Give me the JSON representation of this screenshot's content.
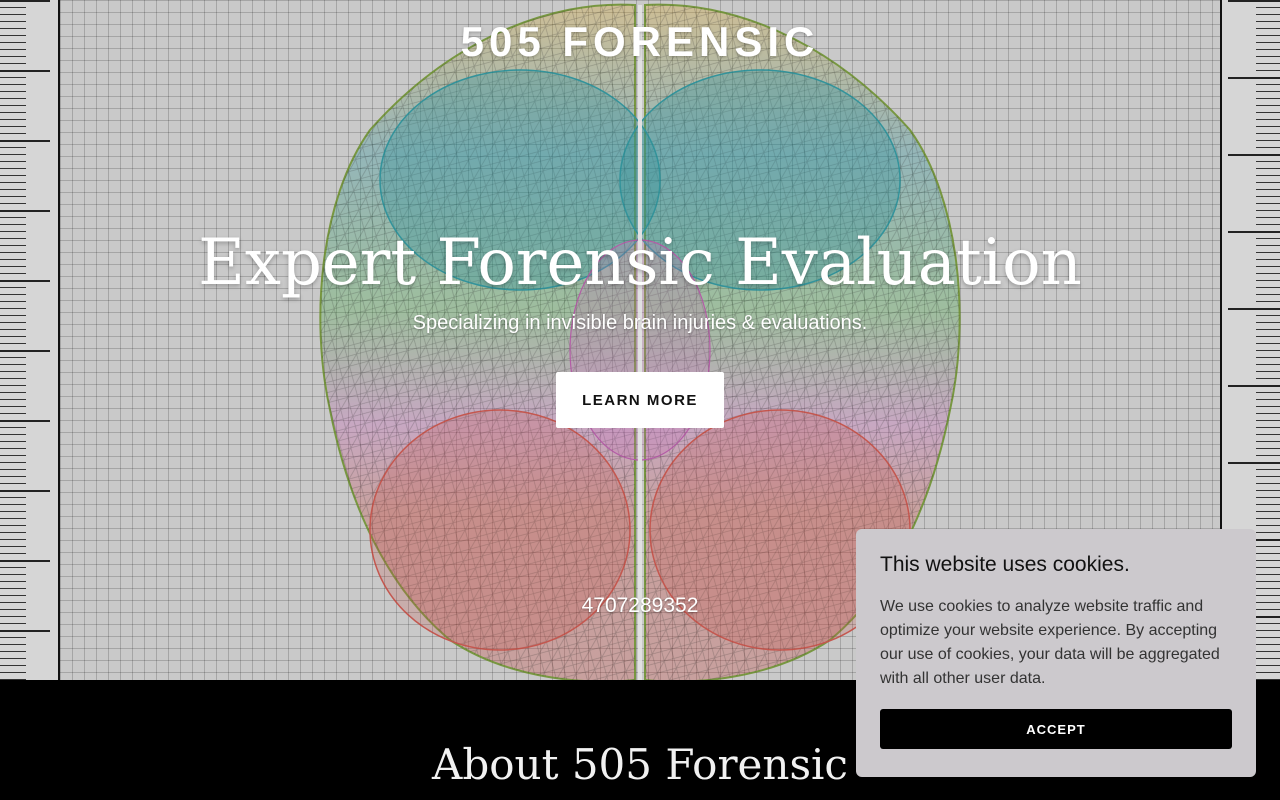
{
  "header": {
    "logo_text": "505 FORENSIC"
  },
  "hero": {
    "headline": "Expert Forensic Evaluation",
    "subheadline": "Specializing in invisible brain injuries & evaluations.",
    "cta_label": "LEARN MORE",
    "phone": "4707289352"
  },
  "about": {
    "heading": "About 505 Forensic"
  },
  "cookie_banner": {
    "title": "This website uses cookies.",
    "body": "We use cookies to analyze website traffic and optimize your website experience. By accepting our use of cookies, your data will be aggregated with all other user data.",
    "accept_label": "ACCEPT"
  },
  "colors": {
    "page_background": "#000000",
    "grid_background": "#c9c9c9",
    "cookie_background": "#ccc9cd",
    "button_dark": "#000000",
    "text_light": "#ffffff"
  },
  "icons": {
    "hero_image": "brain-wireframe"
  }
}
